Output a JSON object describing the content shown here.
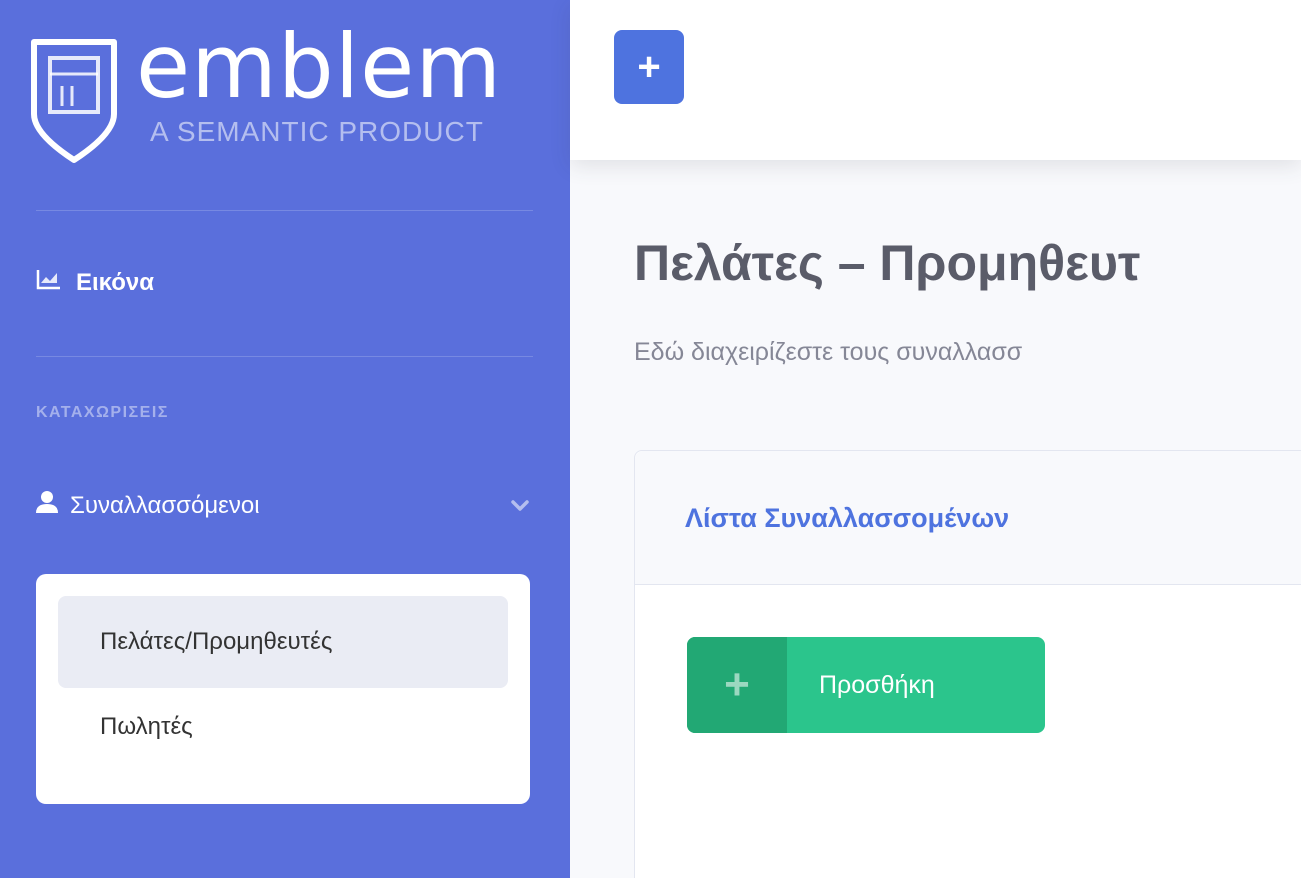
{
  "brand": {
    "name": "emblem",
    "tagline": "A SEMANTIC PRODUCT",
    "logo_icon": "shield-logo-icon"
  },
  "topbar": {
    "add_button_label": "+"
  },
  "sidebar": {
    "dashboard": {
      "label": "Εικόνα",
      "icon": "chart-area-icon"
    },
    "section_heading": "ΚΑΤΑΧΩΡΙΣΕΙΣ",
    "group": {
      "label": "Συναλλασσόμενοι",
      "icon": "user-icon",
      "expanded": true
    },
    "submenu": [
      {
        "label": "Πελάτες/Προμηθευτές",
        "active": true
      },
      {
        "label": "Πωλητές",
        "active": false
      }
    ]
  },
  "main": {
    "title": "Πελάτες – Προμηθευτ",
    "subtitle": "Εδώ διαχειρίζεστε τους συναλλασσ"
  },
  "card": {
    "title": "Λίστα Συναλλασσομένων",
    "add_button": {
      "icon": "+",
      "label": "Προσθήκη"
    }
  },
  "colors": {
    "sidebar": "#5a6fdc",
    "primary": "#4e73df",
    "success": "#2bc58c",
    "success_dark": "#22a874"
  }
}
